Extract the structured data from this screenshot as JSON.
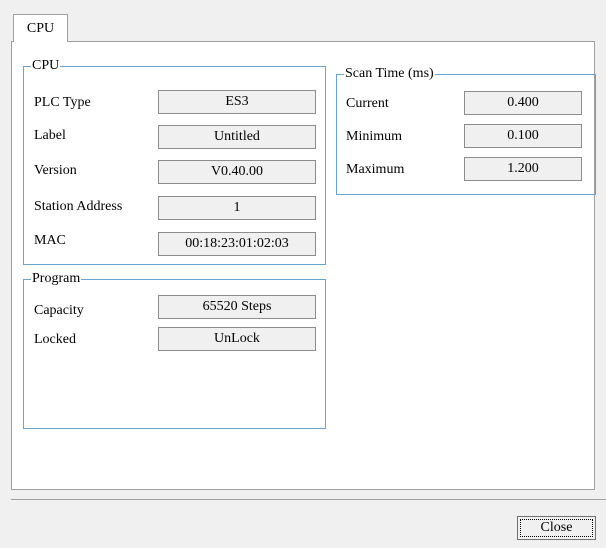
{
  "tab": {
    "label": "CPU"
  },
  "cpu_group": {
    "title": "CPU",
    "rows": [
      {
        "label": "PLC Type",
        "value": "ES3"
      },
      {
        "label": "Label",
        "value": "Untitled"
      },
      {
        "label": "Version",
        "value": "V0.40.00"
      },
      {
        "label": "Station Address",
        "value": "1"
      },
      {
        "label": "MAC",
        "value": "00:18:23:01:02:03"
      }
    ]
  },
  "program_group": {
    "title": "Program",
    "rows": [
      {
        "label": "Capacity",
        "value": "65520 Steps"
      },
      {
        "label": "Locked",
        "value": "UnLock"
      }
    ]
  },
  "scan_group": {
    "title": "Scan Time (ms)",
    "rows": [
      {
        "label": "Current",
        "value": "0.400"
      },
      {
        "label": "Minimum",
        "value": "0.100"
      },
      {
        "label": "Maximum",
        "value": "1.200"
      }
    ]
  },
  "footer": {
    "close_label": "Close"
  }
}
